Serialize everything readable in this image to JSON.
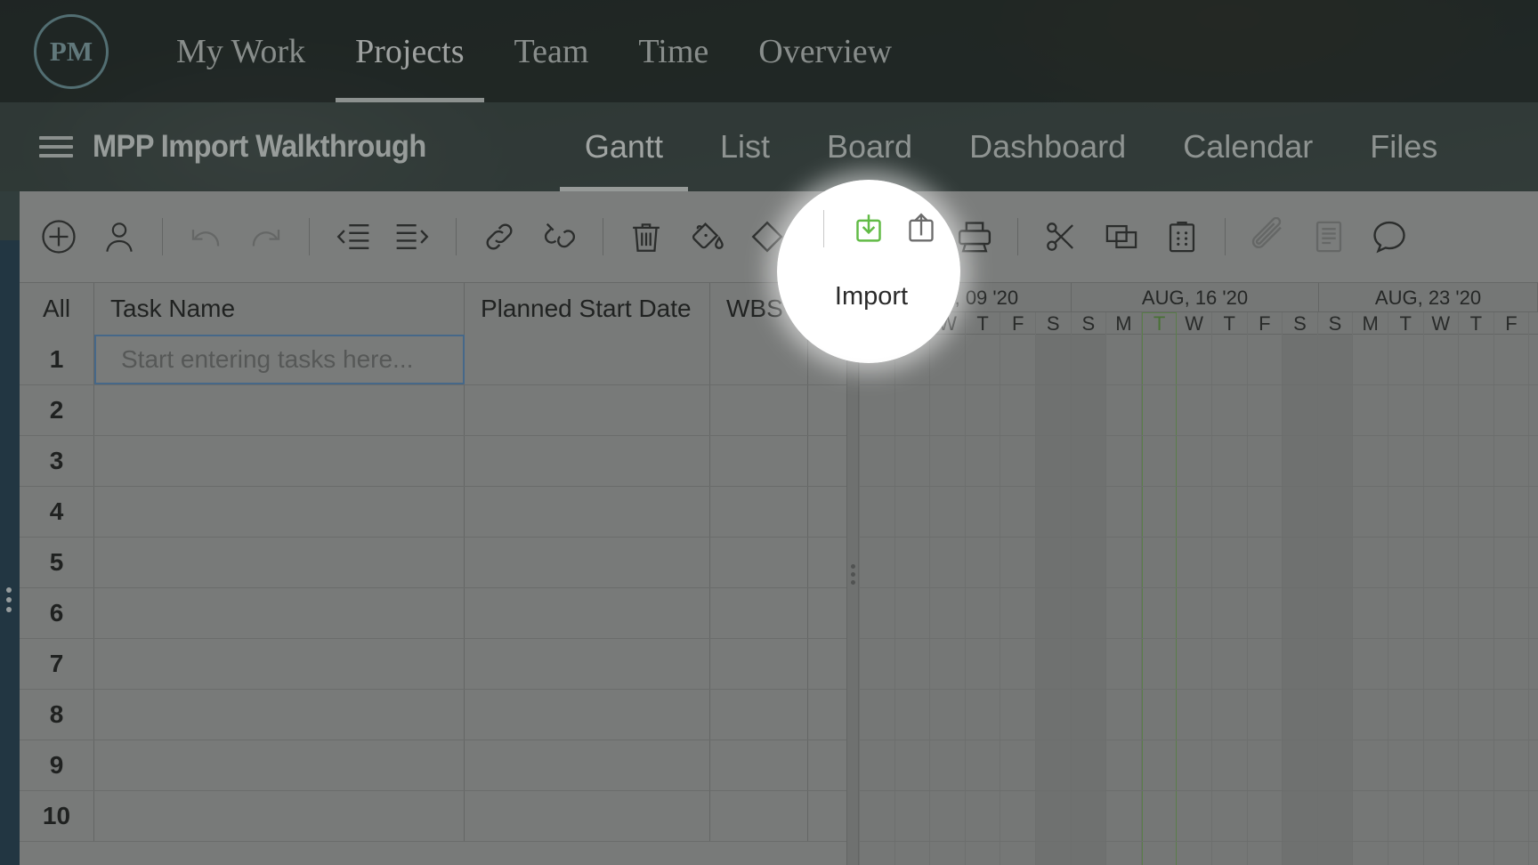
{
  "brand": {
    "logo_text": "PM",
    "accent_teal": "#6f9aa2",
    "accent_green": "#62bb46",
    "rail_blue": "#1f3d52"
  },
  "topnav": {
    "items": [
      {
        "label": "My Work",
        "active": false
      },
      {
        "label": "Projects",
        "active": true
      },
      {
        "label": "Team",
        "active": false
      },
      {
        "label": "Time",
        "active": false
      },
      {
        "label": "Overview",
        "active": false
      }
    ]
  },
  "projectbar": {
    "menu_icon": "hamburger-icon",
    "title": "MPP Import Walkthrough",
    "tabs": [
      {
        "label": "Gantt",
        "active": true
      },
      {
        "label": "List",
        "active": false
      },
      {
        "label": "Board",
        "active": false
      },
      {
        "label": "Dashboard",
        "active": false
      },
      {
        "label": "Calendar",
        "active": false
      },
      {
        "label": "Files",
        "active": false
      }
    ]
  },
  "toolbar": {
    "items": [
      {
        "name": "add-task-button",
        "icon": "plus-circle-icon",
        "state": "enabled"
      },
      {
        "name": "assign-resource-button",
        "icon": "person-icon",
        "state": "enabled"
      },
      {
        "name": "separator-1",
        "icon": "separator",
        "state": "divider"
      },
      {
        "name": "undo-button",
        "icon": "undo-icon",
        "state": "disabled"
      },
      {
        "name": "redo-button",
        "icon": "redo-icon",
        "state": "disabled"
      },
      {
        "name": "separator-2",
        "icon": "separator",
        "state": "divider"
      },
      {
        "name": "outdent-button",
        "icon": "outdent-icon",
        "state": "enabled"
      },
      {
        "name": "indent-button",
        "icon": "indent-icon",
        "state": "enabled"
      },
      {
        "name": "separator-3",
        "icon": "separator",
        "state": "divider"
      },
      {
        "name": "link-tasks-button",
        "icon": "link-icon",
        "state": "enabled"
      },
      {
        "name": "unlink-tasks-button",
        "icon": "unlink-icon",
        "state": "enabled"
      },
      {
        "name": "separator-4",
        "icon": "separator",
        "state": "divider"
      },
      {
        "name": "delete-button",
        "icon": "trash-icon",
        "state": "enabled"
      },
      {
        "name": "fill-color-button",
        "icon": "paint-bucket-icon",
        "state": "enabled"
      },
      {
        "name": "milestone-button",
        "icon": "diamond-icon",
        "state": "enabled"
      },
      {
        "name": "separator-5",
        "icon": "separator",
        "state": "divider"
      },
      {
        "name": "import-button",
        "icon": "import-icon",
        "state": "highlighted"
      },
      {
        "name": "export-button",
        "icon": "export-icon",
        "state": "enabled"
      },
      {
        "name": "print-button",
        "icon": "printer-icon",
        "state": "enabled"
      },
      {
        "name": "separator-6",
        "icon": "separator",
        "state": "divider"
      },
      {
        "name": "cut-button",
        "icon": "scissors-icon",
        "state": "enabled"
      },
      {
        "name": "copy-button",
        "icon": "copy-icon",
        "state": "enabled"
      },
      {
        "name": "paste-button",
        "icon": "clipboard-paste-icon",
        "state": "enabled"
      },
      {
        "name": "separator-7",
        "icon": "separator",
        "state": "divider"
      },
      {
        "name": "attachment-button",
        "icon": "paperclip-icon",
        "state": "disabled"
      },
      {
        "name": "notes-button",
        "icon": "notes-icon",
        "state": "disabled"
      },
      {
        "name": "comments-button",
        "icon": "comment-bubble-icon",
        "state": "enabled"
      }
    ]
  },
  "tooltip": {
    "text": "Import"
  },
  "grid": {
    "columns": [
      {
        "key": "all",
        "label": "All"
      },
      {
        "key": "task_name",
        "label": "Task Name"
      },
      {
        "key": "planned_start_date",
        "label": "Planned Start Date"
      },
      {
        "key": "wbs",
        "label": "WBS"
      }
    ],
    "first_row_placeholder": "Start entering tasks here...",
    "rows": [
      {
        "num": "1",
        "task_name": "",
        "planned_start_date": "",
        "wbs": ""
      },
      {
        "num": "2",
        "task_name": "",
        "planned_start_date": "",
        "wbs": ""
      },
      {
        "num": "3",
        "task_name": "",
        "planned_start_date": "",
        "wbs": ""
      },
      {
        "num": "4",
        "task_name": "",
        "planned_start_date": "",
        "wbs": ""
      },
      {
        "num": "5",
        "task_name": "",
        "planned_start_date": "",
        "wbs": ""
      },
      {
        "num": "6",
        "task_name": "",
        "planned_start_date": "",
        "wbs": ""
      },
      {
        "num": "7",
        "task_name": "",
        "planned_start_date": "",
        "wbs": ""
      },
      {
        "num": "8",
        "task_name": "",
        "planned_start_date": "",
        "wbs": ""
      },
      {
        "num": "9",
        "task_name": "",
        "planned_start_date": "",
        "wbs": ""
      },
      {
        "num": "10",
        "task_name": "",
        "planned_start_date": "",
        "wbs": ""
      }
    ]
  },
  "gantt": {
    "weeks": [
      {
        "label": "AUG, 09 '20",
        "days": 7
      },
      {
        "label": "AUG, 16 '20",
        "days": 7
      },
      {
        "label": "AUG, 23 '20",
        "days": 5
      }
    ],
    "day_letters": [
      "M",
      "T",
      "W",
      "T",
      "F",
      "S",
      "S",
      "M",
      "T",
      "W",
      "T",
      "F",
      "S",
      "S",
      "M",
      "T",
      "W",
      "T",
      "F"
    ],
    "weekend_indices": [
      5,
      6,
      12,
      13
    ],
    "today_index": 8,
    "today_color": "#7cb45f"
  }
}
